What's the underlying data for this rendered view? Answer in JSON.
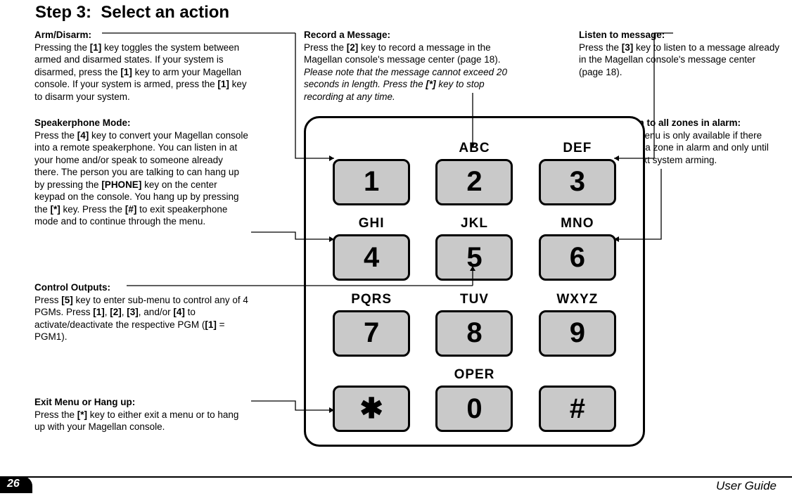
{
  "title": "Step 3:  Select an action",
  "callouts": {
    "arm": {
      "heading": "Arm/Disarm:",
      "body": "Pressing the [1] key toggles the system between armed and disarmed states. If your system is disarmed, press the [1] key to arm your Magellan console. If your system is armed, press the [1] key to disarm your system."
    },
    "record": {
      "heading": "Record a Message:",
      "body_1": "Press the [2] key to record a message in the Magellan console's message center (page 18). ",
      "body_italic": "Please note that the message cannot exceed 20 seconds in length. Press the [*] key to stop recording at any time."
    },
    "listen": {
      "heading": "Listen to message:",
      "body": "Press the [3] key to listen to a message already in the Magellan console's message center (page 18)."
    },
    "speaker": {
      "heading": "Speakerphone Mode:",
      "body": "Press the [4] key to convert your Magellan console into a remote speakerphone. You can listen in at your home and/or speak to someone already there. The person you are talking to can hang up by pressing the [PHONE] key on the center keypad on the console. You hang up by pressing the [*] key. Press the [#] to exit speakerphone mode and to continue through the menu."
    },
    "zones": {
      "heading": "Listen to all zones in alarm:",
      "body": "This menu is only available if there is/was a zone in alarm and only until the next system arming."
    },
    "control": {
      "heading": "Control Outputs:",
      "body": "Press [5] key to enter sub-menu to control any of 4 PGMs. Press [1], [2], [3], and/or [4] to activate/deactivate the respective PGM ([1] = PGM1)."
    },
    "exit": {
      "heading": "Exit Menu or Hang up:",
      "body": "Press the [*] key to either exit a menu or to hang up with your Magellan console."
    }
  },
  "keypad": {
    "labels": [
      "",
      "ABC",
      "DEF",
      "GHI",
      "JKL",
      "MNO",
      "PQRS",
      "TUV",
      "WXYZ",
      "",
      "OPER",
      ""
    ],
    "keys": [
      "1",
      "2",
      "3",
      "4",
      "5",
      "6",
      "7",
      "8",
      "9",
      "✱",
      "0",
      "#"
    ]
  },
  "footer": {
    "page": "26",
    "right": "User Guide"
  }
}
